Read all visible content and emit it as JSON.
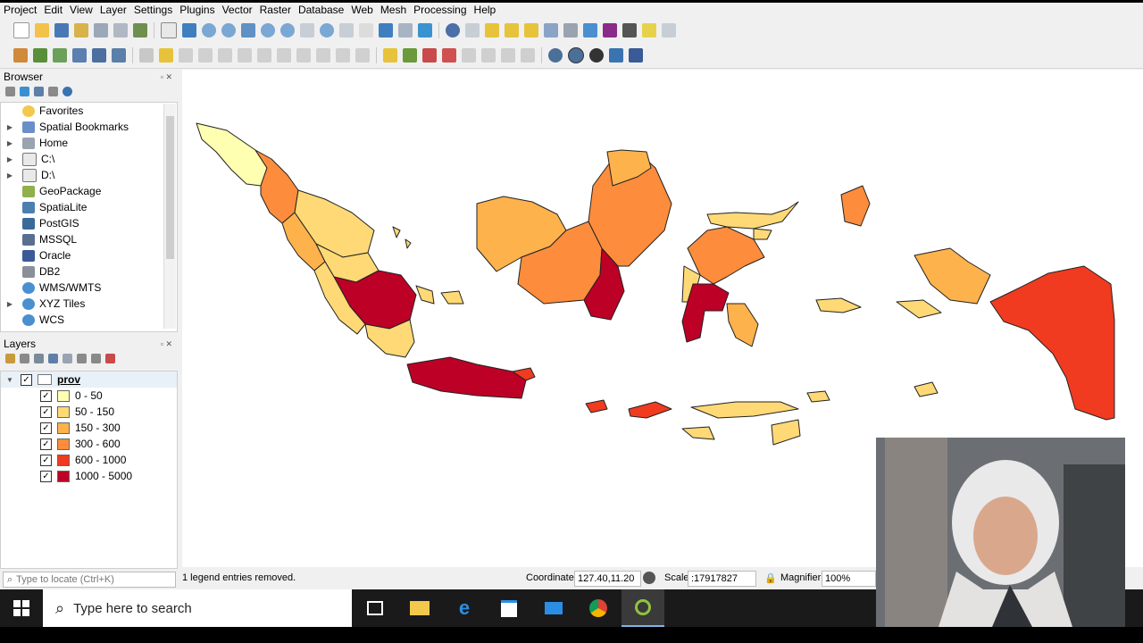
{
  "menu": [
    "Project",
    "Edit",
    "View",
    "Layer",
    "Settings",
    "Plugins",
    "Vector",
    "Raster",
    "Database",
    "Web",
    "Mesh",
    "Processing",
    "Help"
  ],
  "browser": {
    "title": "Browser",
    "items": [
      {
        "label": "Favorites",
        "icon": "star-icon",
        "expand": false
      },
      {
        "label": "Spatial Bookmarks",
        "icon": "bookmark-icon",
        "expand": true
      },
      {
        "label": "Home",
        "icon": "home-icon",
        "expand": true
      },
      {
        "label": "C:\\",
        "icon": "folder-icon",
        "expand": true
      },
      {
        "label": "D:\\",
        "icon": "folder-icon",
        "expand": true
      },
      {
        "label": "GeoPackage",
        "icon": "geopackage-icon",
        "expand": false
      },
      {
        "label": "SpatiaLite",
        "icon": "spatialite-icon",
        "expand": false
      },
      {
        "label": "PostGIS",
        "icon": "postgis-icon",
        "expand": false
      },
      {
        "label": "MSSQL",
        "icon": "mssql-icon",
        "expand": false
      },
      {
        "label": "Oracle",
        "icon": "oracle-icon",
        "expand": false
      },
      {
        "label": "DB2",
        "icon": "db2-icon",
        "expand": false
      },
      {
        "label": "WMS/WMTS",
        "icon": "globe-icon",
        "expand": false
      },
      {
        "label": "XYZ Tiles",
        "icon": "globe-icon",
        "expand": true
      },
      {
        "label": "WCS",
        "icon": "globe-icon",
        "expand": false
      }
    ]
  },
  "layers": {
    "title": "Layers",
    "layer_name": "prov",
    "legend": [
      {
        "label": "0 - 50",
        "color": "#ffffb2"
      },
      {
        "label": "50 - 150",
        "color": "#fed976"
      },
      {
        "label": "150 - 300",
        "color": "#feb24c"
      },
      {
        "label": "300 - 600",
        "color": "#fd8d3c"
      },
      {
        "label": "600 - 1000",
        "color": "#f03b20"
      },
      {
        "label": "1000 - 5000",
        "color": "#bd0026"
      }
    ]
  },
  "status": {
    "locator_placeholder": "Type to locate (Ctrl+K)",
    "message": "1 legend entries removed.",
    "coordinate_label": "Coordinate",
    "coordinate_value": "127.40,11.20",
    "scale_label": "Scale",
    "scale_value": ":17917827",
    "magnifier_label": "Magnifier",
    "magnifier_value": "100%"
  },
  "taskbar": {
    "search_placeholder": "Type here to search"
  }
}
